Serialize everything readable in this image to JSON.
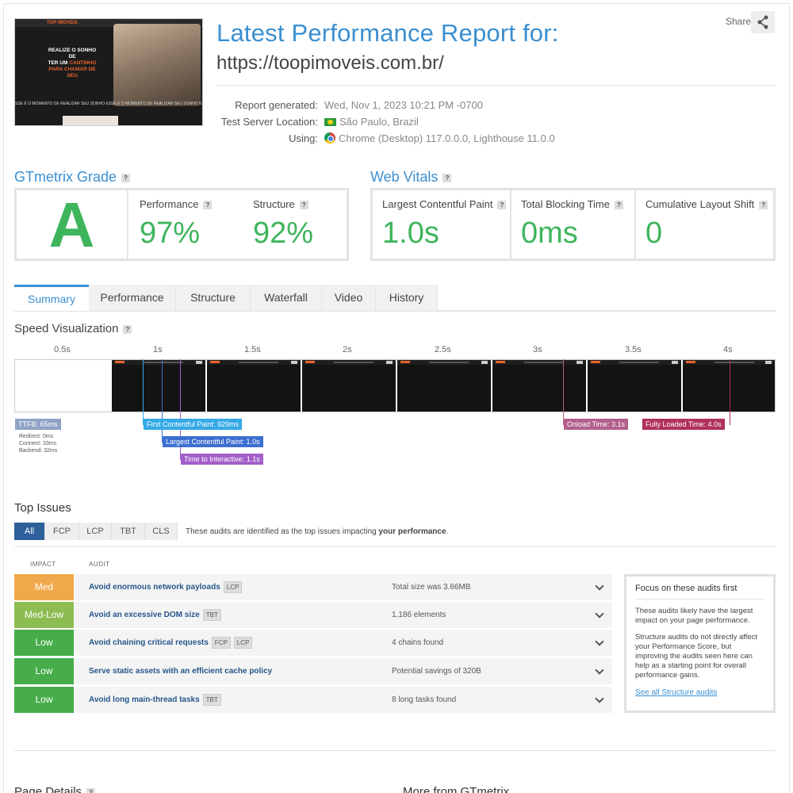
{
  "header": {
    "title": "Latest Performance Report for:",
    "url": "https://toopimoveis.com.br/",
    "share_label": "Share",
    "meta": [
      {
        "key": "Report generated:",
        "value": "Wed, Nov 1, 2023 10:21 PM -0700"
      },
      {
        "key": "Test Server Location:",
        "value": "São Paulo, Brazil"
      },
      {
        "key": "Using:",
        "value": "Chrome (Desktop) 117.0.0.0, Lighthouse 11.0.0"
      }
    ]
  },
  "thumbnail": {
    "logo": "TOP IMOVEIS",
    "headline_1": "REALIZE O SONHO DE",
    "headline_2": "TER UM",
    "headline_highlight": "CANTINHO",
    "headline_3": "PARA CHAMAR DE SEU",
    "ticker": "SSE É O MOMENTO DE REALIZAR SEU SONHO  ESSE É O MOMENTO DE REALIZAR SEU SONHO  ESSE É O MOMENTO DE R"
  },
  "grade": {
    "title": "GTmetrix Grade",
    "letter": "A",
    "performance_label": "Performance",
    "performance_value": "97%",
    "structure_label": "Structure",
    "structure_value": "92%"
  },
  "vitals": {
    "title": "Web Vitals",
    "lcp_label": "Largest Contentful Paint",
    "lcp_value": "1.0s",
    "tbt_label": "Total Blocking Time",
    "tbt_value": "0ms",
    "cls_label": "Cumulative Layout Shift",
    "cls_value": "0"
  },
  "tabs": [
    "Summary",
    "Performance",
    "Structure",
    "Waterfall",
    "Video",
    "History"
  ],
  "speed": {
    "title": "Speed Visualization",
    "ticks": [
      "0.5s",
      "1s",
      "1.5s",
      "2s",
      "2.5s",
      "3s",
      "3.5s",
      "4s"
    ],
    "markers": {
      "ttfb": "TTFB: 65ms",
      "redirect": "Redirect: 0ms",
      "connect": "Connect: 33ms",
      "backend": "Backend: 32ms",
      "fcp": "First Contentful Paint: 929ms",
      "lcp": "Largest Contentful Paint: 1.0s",
      "tti": "Time to Interactive: 1.1s",
      "onload": "Onload Time: 3.1s",
      "fully": "Fully Loaded Time: 4.0s"
    }
  },
  "issues": {
    "title": "Top Issues",
    "filters": [
      "All",
      "FCP",
      "LCP",
      "TBT",
      "CLS"
    ],
    "desc_prefix": "These audits are identified as the top issues impacting ",
    "desc_bold": "your performance",
    "desc_suffix": ".",
    "col_impact": "IMPACT",
    "col_audit": "AUDIT",
    "rows": [
      {
        "impact": "Med",
        "color": "#f0a94a",
        "audit": "Avoid enormous network payloads",
        "tags": [
          "LCP"
        ],
        "result": "Total size was 3.66MB"
      },
      {
        "impact": "Med-Low",
        "color": "#8dbd52",
        "audit": "Avoid an excessive DOM size",
        "tags": [
          "TBT"
        ],
        "result": "1,186 elements"
      },
      {
        "impact": "Low",
        "color": "#46ad4a",
        "audit": "Avoid chaining critical requests",
        "tags": [
          "FCP",
          "LCP"
        ],
        "result": "4 chains found"
      },
      {
        "impact": "Low",
        "color": "#46ad4a",
        "audit": "Serve static assets with an efficient cache policy",
        "tags": [],
        "result": "Potential savings of 320B"
      },
      {
        "impact": "Low",
        "color": "#46ad4a",
        "audit": "Avoid long main-thread tasks",
        "tags": [
          "TBT"
        ],
        "result": "8 long tasks found"
      }
    ],
    "focus": {
      "title": "Focus on these audits first",
      "p1": "These audits likely have the largest impact on your page performance.",
      "p2": "Structure audits do not directly affect your Performance Score, but improving the audits seen here can help as a starting point for overall performance gains.",
      "link": "See all Structure audits"
    }
  },
  "bottom": {
    "left": "Page Details",
    "right": "More from GTmetrix"
  },
  "colors": {
    "accent": "#3a8fd1",
    "grade_green": "#3eb55c",
    "ttfb": "#8fa3c5",
    "fcp": "#35a9e6",
    "lcp": "#3d6fd1",
    "tti": "#a35fc9",
    "onload": "#b25f8c",
    "fully": "#b0305e"
  }
}
